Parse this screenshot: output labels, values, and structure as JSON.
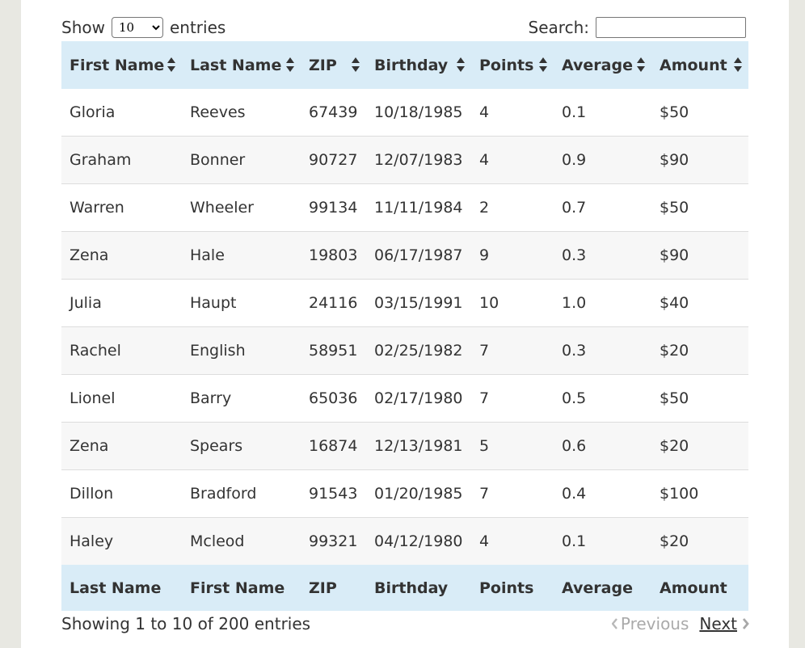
{
  "controls": {
    "show_label": "Show",
    "length_value": "10",
    "entries_label": "entries",
    "search_label": "Search:",
    "search_value": ""
  },
  "table": {
    "header": [
      "First Name",
      "Last Name",
      "ZIP",
      "Birthday",
      "Points",
      "Average",
      "Amount"
    ],
    "footer": [
      "Last Name",
      "First Name",
      "ZIP",
      "Birthday",
      "Points",
      "Average",
      "Amount"
    ],
    "rows": [
      [
        "Gloria",
        "Reeves",
        "67439",
        "10/18/1985",
        "4",
        "0.1",
        "$50"
      ],
      [
        "Graham",
        "Bonner",
        "90727",
        "12/07/1983",
        "4",
        "0.9",
        "$90"
      ],
      [
        "Warren",
        "Wheeler",
        "99134",
        "11/11/1984",
        "2",
        "0.7",
        "$50"
      ],
      [
        "Zena",
        "Hale",
        "19803",
        "06/17/1987",
        "9",
        "0.3",
        "$90"
      ],
      [
        "Julia",
        "Haupt",
        "24116",
        "03/15/1991",
        "10",
        "1.0",
        "$40"
      ],
      [
        "Rachel",
        "English",
        "58951",
        "02/25/1982",
        "7",
        "0.3",
        "$20"
      ],
      [
        "Lionel",
        "Barry",
        "65036",
        "02/17/1980",
        "7",
        "0.5",
        "$50"
      ],
      [
        "Zena",
        "Spears",
        "16874",
        "12/13/1981",
        "5",
        "0.6",
        "$20"
      ],
      [
        "Dillon",
        "Bradford",
        "91543",
        "01/20/1985",
        "7",
        "0.4",
        "$100"
      ],
      [
        "Haley",
        "Mcleod",
        "99321",
        "04/12/1980",
        "4",
        "0.1",
        "$20"
      ]
    ]
  },
  "footer": {
    "info": "Showing 1 to 10 of 200 entries",
    "previous": "Previous",
    "next": "Next"
  },
  "colors": {
    "header_bg": "#d9ecf7",
    "stripe": "#f7f7f7",
    "disabled": "#aaaaaa"
  },
  "icons": {
    "sort": "sort-both-icon",
    "previous": "chevron-left-icon",
    "next": "chevron-right-icon"
  }
}
